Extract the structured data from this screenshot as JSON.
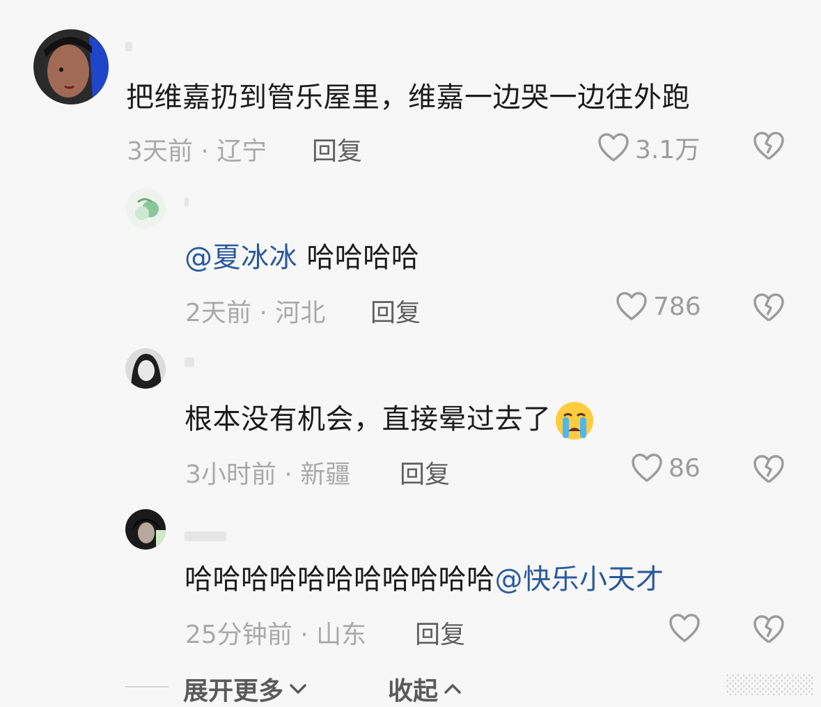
{
  "comments": [
    {
      "text": "把维嘉扔到管乐屋里，维嘉一边哭一边往外跑",
      "meta": "3天前 · 辽宁",
      "reply": "回复",
      "likes": "3.1万"
    },
    {
      "mention": "@夏冰冰",
      "text": " 哈哈哈哈",
      "meta": "2天前 · 河北",
      "reply": "回复",
      "likes": "786"
    },
    {
      "text": "根本没有机会，直接晕过去了",
      "emoji": "loudly-crying-face",
      "meta": "3小时前 · 新疆",
      "reply": "回复",
      "likes": "86"
    },
    {
      "text": "哈哈哈哈哈哈哈哈哈哈哈",
      "mention": "@快乐小天才",
      "meta": "25分钟前 · 山东",
      "reply": "回复",
      "likes": ""
    }
  ],
  "footer": {
    "expand_label": "展开更多",
    "collapse_label": "收起"
  },
  "colors": {
    "mention": "#2a5a9c",
    "meta": "#a9a9a9",
    "background": "#f7f7f7"
  }
}
